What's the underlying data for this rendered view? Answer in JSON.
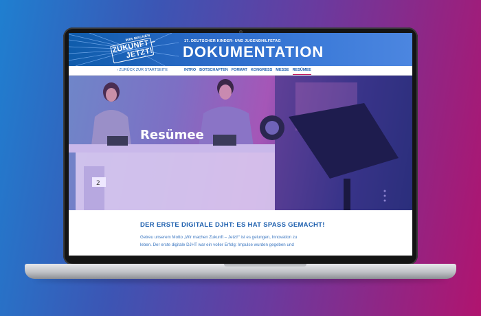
{
  "header": {
    "logo": {
      "line1": "WIR MACHEN",
      "line2": "ZUKUNFT –",
      "line3": "JETZT!"
    },
    "supertitle": "17. DEUTSCHER KINDER- UND JUGENDHILFETAG",
    "title": "DOKUMENTATION"
  },
  "nav": {
    "back_link": "‹ ZURÜCK ZUR STARTSEITE",
    "items": [
      {
        "label": "INTRO"
      },
      {
        "label": "BOTSCHAFTEN"
      },
      {
        "label": "FORMAT"
      },
      {
        "label": "KONGRESS"
      },
      {
        "label": "MESSE"
      },
      {
        "label": "RESÜMEE"
      }
    ],
    "active": "RESÜMEE"
  },
  "hero": {
    "title": "Resümee",
    "desk_number": "2"
  },
  "content": {
    "heading": "DER ERSTE DIGITALE DJHT: ES HAT SPASS GEMACHT!",
    "line1": "Getreu unserem Motto „Wir machen Zukunft – Jetzt!“ ist es gelungen, Innovation zu",
    "line2": "leben. Der erste digitale DJHT war ein voller Erfolg: Impulse wurden gegeben und"
  },
  "colors": {
    "header_blue": "#1d5fae",
    "accent_magenta": "#c2185b"
  }
}
